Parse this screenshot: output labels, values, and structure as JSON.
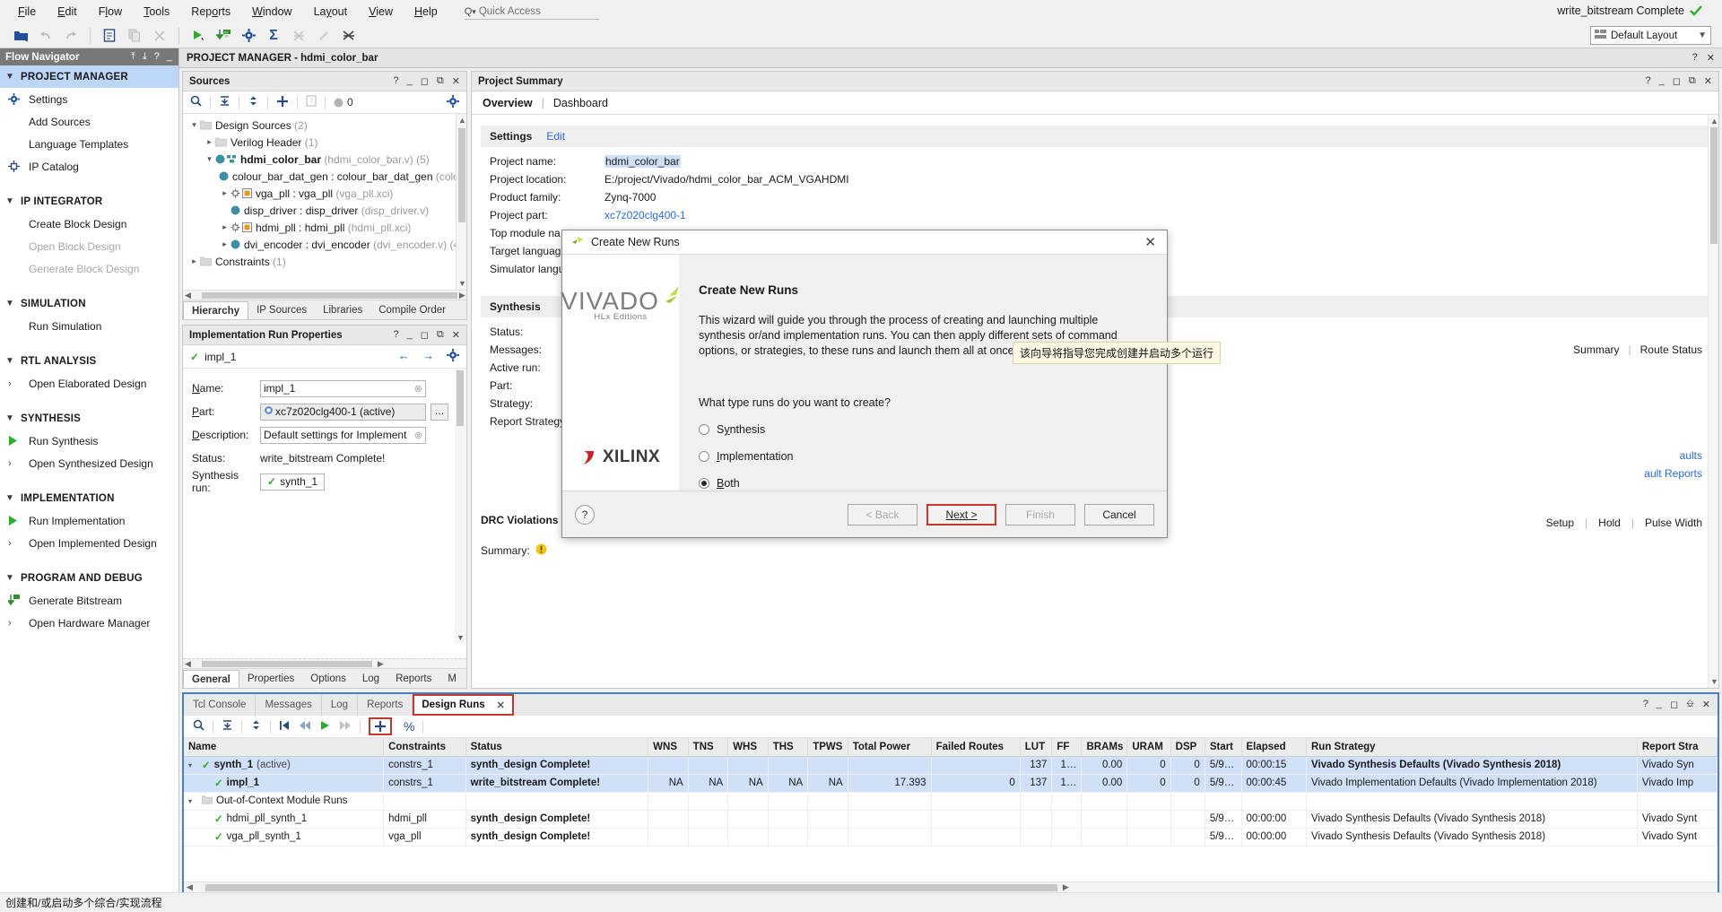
{
  "app": {
    "title_bar_status": "write_bitstream Complete",
    "layout_selector": "Default Layout",
    "status_bar": "创建和/或启动多个综合/实现流程"
  },
  "menu": {
    "items": [
      "File",
      "Edit",
      "Flow",
      "Tools",
      "Reports",
      "Window",
      "Layout",
      "View",
      "Help"
    ],
    "quick_access_placeholder": "Quick Access"
  },
  "toolbar": {
    "icons": [
      "open-folder-icon",
      "undo-icon",
      "redo-icon",
      "report-icon",
      "copy-icon",
      "close-x-icon",
      "run-icon",
      "download-bitstream-icon",
      "settings-gear-icon",
      "sigma-icon",
      "timing-icon",
      "clip-icon",
      "unmark-icon"
    ]
  },
  "flow_navigator": {
    "title": "Flow Navigator",
    "sections": [
      {
        "label": "PROJECT MANAGER",
        "selected": true,
        "items": [
          {
            "label": "Settings",
            "icon": "gear-icon",
            "disabled": false
          },
          {
            "label": "Add Sources",
            "icon": "",
            "disabled": false
          },
          {
            "label": "Language Templates",
            "icon": "",
            "disabled": false
          },
          {
            "label": "IP Catalog",
            "icon": "ip-icon",
            "disabled": false
          }
        ]
      },
      {
        "label": "IP INTEGRATOR",
        "selected": false,
        "items": [
          {
            "label": "Create Block Design",
            "icon": "",
            "disabled": false
          },
          {
            "label": "Open Block Design",
            "icon": "",
            "disabled": true
          },
          {
            "label": "Generate Block Design",
            "icon": "",
            "disabled": true
          }
        ]
      },
      {
        "label": "SIMULATION",
        "selected": false,
        "items": [
          {
            "label": "Run Simulation",
            "icon": "",
            "disabled": false
          }
        ]
      },
      {
        "label": "RTL ANALYSIS",
        "selected": false,
        "items": [
          {
            "label": "Open Elaborated Design",
            "icon": "chevron-right-icon",
            "disabled": false
          }
        ]
      },
      {
        "label": "SYNTHESIS",
        "selected": false,
        "items": [
          {
            "label": "Run Synthesis",
            "icon": "play-icon",
            "disabled": false
          },
          {
            "label": "Open Synthesized Design",
            "icon": "chevron-right-icon",
            "disabled": false
          }
        ]
      },
      {
        "label": "IMPLEMENTATION",
        "selected": false,
        "items": [
          {
            "label": "Run Implementation",
            "icon": "play-icon",
            "disabled": false
          },
          {
            "label": "Open Implemented Design",
            "icon": "chevron-right-icon",
            "disabled": false
          }
        ]
      },
      {
        "label": "PROGRAM AND DEBUG",
        "selected": false,
        "items": [
          {
            "label": "Generate Bitstream",
            "icon": "bitstream-icon",
            "disabled": false
          },
          {
            "label": "Open Hardware Manager",
            "icon": "chevron-right-icon",
            "disabled": false
          }
        ]
      }
    ]
  },
  "project_manager_bar": {
    "title": "PROJECT MANAGER - hdmi_color_bar"
  },
  "sources": {
    "title": "Sources",
    "toolbar_icons": [
      "search-icon",
      "collapse-all-icon",
      "expand-all-icon",
      "add-sources-icon",
      "help-icon",
      "status-dot-icon"
    ],
    "badge_count": "0",
    "tree": [
      {
        "indent": 0,
        "expander": "v",
        "icon": "folder-icon",
        "label": "Design Sources",
        "suffix": "(2)",
        "bold": false
      },
      {
        "indent": 1,
        "expander": ">",
        "icon": "folder-icon",
        "label": "Verilog Header",
        "suffix": "(1)",
        "bold": false
      },
      {
        "indent": 1,
        "expander": "v",
        "icon": "module-icon",
        "label": "hdmi_color_bar",
        "suffix": "(hdmi_color_bar.v) (5)",
        "bold": true
      },
      {
        "indent": 2,
        "expander": "",
        "icon": "inst-icon",
        "label": "colour_bar_dat_gen : colour_bar_dat_gen",
        "suffix": "(colour_ba",
        "bold": false
      },
      {
        "indent": 2,
        "expander": ">",
        "icon": "ip-core-icon",
        "label": "vga_pll : vga_pll",
        "suffix": "(vga_pll.xci)",
        "bold": false
      },
      {
        "indent": 2,
        "expander": "",
        "icon": "inst-icon",
        "label": "disp_driver : disp_driver",
        "suffix": "(disp_driver.v)",
        "bold": false
      },
      {
        "indent": 2,
        "expander": ">",
        "icon": "ip-core-icon",
        "label": "hdmi_pll : hdmi_pll",
        "suffix": "(hdmi_pll.xci)",
        "bold": false
      },
      {
        "indent": 2,
        "expander": ">",
        "icon": "inst-icon",
        "label": "dvi_encoder : dvi_encoder",
        "suffix": "(dvi_encoder.v) (4)",
        "bold": false
      },
      {
        "indent": 0,
        "expander": ">",
        "icon": "folder-icon",
        "label": "Constraints",
        "suffix": "(1)",
        "bold": false
      }
    ],
    "tabs": [
      "Hierarchy",
      "IP Sources",
      "Libraries",
      "Compile Order"
    ],
    "active_tab": "Hierarchy"
  },
  "impl_props": {
    "title": "Implementation Run Properties",
    "run_name": "impl_1",
    "fields": {
      "name_label": "Name:",
      "name_value": "impl_1",
      "part_label": "Part:",
      "part_value": "xc7z020clg400-1 (active)",
      "description_label": "Description:",
      "description_value": "Default settings for Implementation.",
      "status_label": "Status:",
      "status_value": "write_bitstream Complete!",
      "synthesis_run_label": "Synthesis run:",
      "synthesis_run_value": "synth_1"
    },
    "tabs": [
      "General",
      "Properties",
      "Options",
      "Log",
      "Reports",
      "M"
    ],
    "active_tab": "General"
  },
  "project_summary": {
    "title": "Project Summary",
    "tabs": [
      "Overview",
      "Dashboard"
    ],
    "active_tab": "Overview",
    "settings_section": {
      "label": "Settings",
      "edit_link": "Edit"
    },
    "rows": [
      {
        "key": "Project name:",
        "value": "hdmi_color_bar",
        "style": "highlight"
      },
      {
        "key": "Project location:",
        "value": "E:/project/Vivado/hdmi_color_bar_ACM_VGAHDMI",
        "style": "plain"
      },
      {
        "key": "Product family:",
        "value": "Zynq-7000",
        "style": "plain"
      },
      {
        "key": "Project part:",
        "value": "xc7z020clg400-1",
        "style": "link"
      },
      {
        "key": "Top module na",
        "value": "",
        "style": "plain"
      },
      {
        "key": "Target languag",
        "value": "",
        "style": "plain"
      },
      {
        "key": "Simulator langu",
        "value": "",
        "style": "plain"
      }
    ],
    "synthesis_section": "Synthesis",
    "synthesis_rows": [
      "Status:",
      "Messages:",
      "Active run:",
      "Part:",
      "Strategy:",
      "Report Strategy"
    ],
    "summary_right": {
      "summary": "Summary",
      "route_status": "Route Status"
    },
    "links": [
      "aults",
      "ault Reports"
    ],
    "setup_row": [
      "Setup",
      "Hold",
      "Pulse Width"
    ],
    "drc_section": "DRC Violations",
    "drc_summary_label": "Summary:"
  },
  "dialog": {
    "title": "Create New Runs",
    "heading": "Create New Runs",
    "description": "This wizard will guide you through the process of creating and launching multiple synthesis or/and implementation runs. You can then apply different sets of command options, or strategies, to these runs and launch them all at once.",
    "tooltip": "该向导将指导您完成创建并启动多个运行",
    "question": "What type runs do you want to create?",
    "options": [
      {
        "label": "Synthesis",
        "mnemonic": "y",
        "selected": false
      },
      {
        "label": "Implementation",
        "mnemonic": "I",
        "selected": false
      },
      {
        "label": "Both",
        "mnemonic": "B",
        "selected": true
      }
    ],
    "logo_text": "VIVADO",
    "logo_sub": "HLx Editions",
    "vendor_text": "XILINX",
    "help_icon": "question-mark-icon",
    "buttons": [
      {
        "label": "< Back",
        "state": "disabled"
      },
      {
        "label": "Next >",
        "state": "default"
      },
      {
        "label": "Finish",
        "state": "disabled"
      },
      {
        "label": "Cancel",
        "state": "normal"
      }
    ]
  },
  "bottom_panel": {
    "tabs": [
      "Tcl Console",
      "Messages",
      "Log",
      "Reports",
      "Design Runs"
    ],
    "active_tab": "Design Runs",
    "toolbar_icons": [
      "search-icon",
      "collapse-icon",
      "expand-icon",
      "first-icon",
      "rewind-icon",
      "play-icon",
      "forward-icon",
      "add-icon",
      "percent-icon"
    ],
    "columns": [
      "Name",
      "Constraints",
      "Status",
      "WNS",
      "TNS",
      "WHS",
      "THS",
      "TPWS",
      "Total Power",
      "Failed Routes",
      "LUT",
      "FF",
      "BRAMs",
      "URAM",
      "DSP",
      "Start",
      "Elapsed",
      "Run Strategy",
      "Report Stra"
    ],
    "rows": [
      {
        "expander": "v",
        "check": true,
        "indent": 0,
        "name": "synth_1",
        "name_suffix": "(active)",
        "bold": true,
        "constraints": "constrs_1",
        "status": "synth_design Complete!",
        "wns": "",
        "tns": "",
        "whs": "",
        "ths": "",
        "tpws": "",
        "total_power": "",
        "failed_routes": "",
        "lut": "137",
        "ff": "1…",
        "brams": "0.00",
        "uram": "0",
        "dsp": "0",
        "start": "5/9…",
        "elapsed": "00:00:15",
        "run_strategy": "Vivado Synthesis Defaults (Vivado Synthesis 2018)",
        "report_strategy": "Vivado Syn",
        "selected": true,
        "strategy_bold": true
      },
      {
        "expander": "",
        "check": true,
        "indent": 1,
        "name": "impl_1",
        "name_suffix": "",
        "bold": true,
        "constraints": "constrs_1",
        "status": "write_bitstream Complete!",
        "wns": "NA",
        "tns": "NA",
        "whs": "NA",
        "ths": "NA",
        "tpws": "NA",
        "total_power": "17.393",
        "failed_routes": "0",
        "lut": "137",
        "ff": "1…",
        "brams": "0.00",
        "uram": "0",
        "dsp": "0",
        "start": "5/9…",
        "elapsed": "00:00:45",
        "run_strategy": "Vivado Implementation Defaults (Vivado Implementation 2018)",
        "report_strategy": "Vivado Imp",
        "selected": true,
        "strategy_bold": false
      },
      {
        "expander": "v",
        "check": false,
        "indent": 0,
        "group": true,
        "name": "Out-of-Context Module Runs",
        "name_suffix": "",
        "bold": false,
        "constraints": "",
        "status": "",
        "wns": "",
        "tns": "",
        "whs": "",
        "ths": "",
        "tpws": "",
        "total_power": "",
        "failed_routes": "",
        "lut": "",
        "ff": "",
        "brams": "",
        "uram": "",
        "dsp": "",
        "start": "",
        "elapsed": "",
        "run_strategy": "",
        "report_strategy": "",
        "selected": false,
        "strategy_bold": false
      },
      {
        "expander": "",
        "check": true,
        "indent": 1,
        "name": "hdmi_pll_synth_1",
        "name_suffix": "",
        "bold": false,
        "constraints": "hdmi_pll",
        "status": "synth_design Complete!",
        "wns": "",
        "tns": "",
        "whs": "",
        "ths": "",
        "tpws": "",
        "total_power": "",
        "failed_routes": "",
        "lut": "",
        "ff": "",
        "brams": "",
        "uram": "",
        "dsp": "",
        "start": "5/9…",
        "elapsed": "00:00:00",
        "run_strategy": "Vivado Synthesis Defaults (Vivado Synthesis 2018)",
        "report_strategy": "Vivado Synt",
        "selected": false,
        "strategy_bold": false
      },
      {
        "expander": "",
        "check": true,
        "indent": 1,
        "name": "vga_pll_synth_1",
        "name_suffix": "",
        "bold": false,
        "constraints": "vga_pll",
        "status": "synth_design Complete!",
        "wns": "",
        "tns": "",
        "whs": "",
        "ths": "",
        "tpws": "",
        "total_power": "",
        "failed_routes": "",
        "lut": "",
        "ff": "",
        "brams": "",
        "uram": "",
        "dsp": "",
        "start": "5/9…",
        "elapsed": "00:00:00",
        "run_strategy": "Vivado Synthesis Defaults (Vivado Synthesis 2018)",
        "report_strategy": "Vivado Synt",
        "selected": false,
        "strategy_bold": false
      }
    ]
  },
  "colors": {
    "accent_blue": "#2a6bd4",
    "selection_blue": "#cfe0f7",
    "green_check": "#2faa2f",
    "highlight_red": "#c0392b",
    "nav_selected": "#bcd6f5"
  }
}
